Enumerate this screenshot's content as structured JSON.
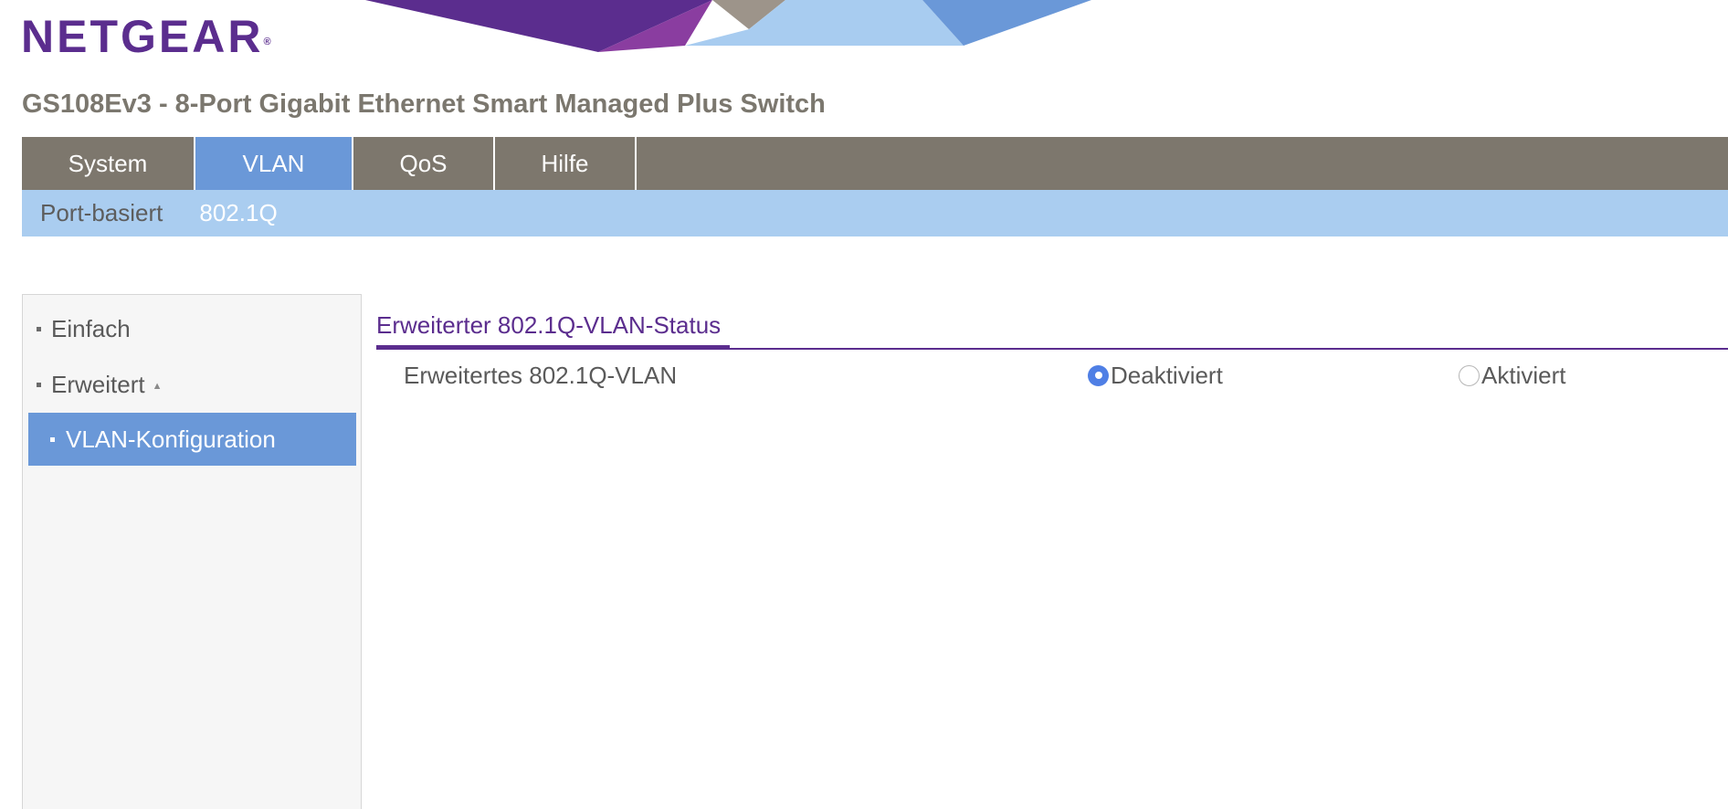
{
  "brand": {
    "logo_text": "NETGEAR",
    "logo_mark": "®"
  },
  "product_title": "GS108Ev3 - 8-Port Gigabit Ethernet Smart Managed Plus Switch",
  "main_nav": {
    "tabs": [
      {
        "label": "System",
        "active": false
      },
      {
        "label": "VLAN",
        "active": true
      },
      {
        "label": "QoS",
        "active": false
      },
      {
        "label": "Hilfe",
        "active": false
      }
    ]
  },
  "sub_nav": {
    "tabs": [
      {
        "label": "Port-basiert",
        "active": false
      },
      {
        "label": "802.1Q",
        "active": true
      }
    ]
  },
  "side_menu": {
    "items": [
      {
        "label": "Einfach"
      },
      {
        "label": "Erweitert",
        "expanded": true,
        "caret_icon": "caret-up-icon"
      },
      {
        "label": "VLAN-Konfiguration",
        "selected": true
      }
    ]
  },
  "section": {
    "title": "Erweiterter 802.1Q-VLAN-Status",
    "row_label": "Erweitertes 802.1Q-VLAN",
    "options": [
      {
        "label": "Deaktiviert",
        "checked": true
      },
      {
        "label": "Aktiviert",
        "checked": false
      }
    ]
  },
  "colors": {
    "brand_purple": "#5b2d8e",
    "nav_gray": "#7d776d",
    "active_blue": "#6a98d8",
    "subnav_light_blue": "#aacdf0",
    "radio_blue": "#4f7fe5"
  }
}
